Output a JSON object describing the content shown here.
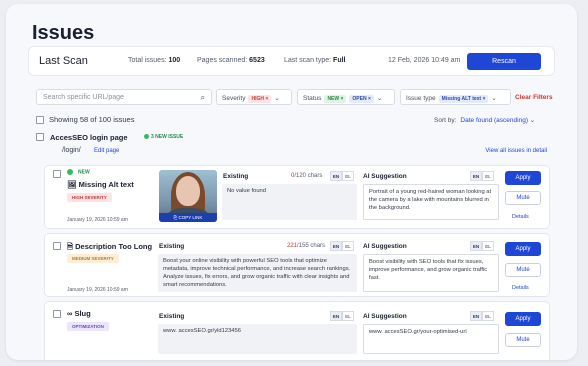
{
  "page": {
    "title": "Issues"
  },
  "scan": {
    "title": "Last Scan",
    "total_label": "Total issues:",
    "total_value": "100",
    "pages_label": "Pages scanned:",
    "pages_value": "6523",
    "type_label": "Last scan type:",
    "type_value": "Full",
    "date": "12 Feb, 2026 10:49 am",
    "rescan": "Rescan"
  },
  "filters": {
    "search_placeholder": "Search specific URL/page",
    "severity_label": "Severity",
    "severity_chip": "HIGH ×",
    "status_label": "Status",
    "status_chip_1": "NEW ×",
    "status_chip_2": "OPEN ×",
    "issue_type_label": "Issue type",
    "issue_type_chip": "Missing ALT text ×",
    "clear": "Clear Filters"
  },
  "list": {
    "showing": "Showing 58 of 100 issues",
    "sort_label": "Sort by:",
    "sort_value": "Date found (ascending)"
  },
  "group": {
    "name": "AccesSEO login page",
    "badge": "3 NEW ISSUE",
    "path": "/login/",
    "edit": "Edit page",
    "view_all": "View all issues in detail"
  },
  "cards": [
    {
      "status": "NEW",
      "title": "Missing Alt text",
      "severity": "HIGH SEVERITY",
      "date": "January 19, 2026 10:59 am",
      "copy_link": "COPY LINK",
      "existing_label": "Existing",
      "chars_used": "0",
      "chars_total": "/120 chars",
      "existing_text": "No value found",
      "ai_label": "AI Suggestion",
      "ai_text": "Portrait of a young red-haired woman looking at the camera by a lake with mountains blurred in the background.",
      "apply": "Apply",
      "mute": "Mute",
      "details": "Details",
      "lang_en": "EN",
      "lang_el": "EL"
    },
    {
      "title": "Description Too Long",
      "severity": "MEDIUM SEVERITY",
      "date": "January 19, 2026 10:59 am",
      "existing_label": "Existing",
      "chars_used": "221",
      "chars_total": "/155 chars",
      "existing_text": "Boost your online visibility with powerful SEO tools that optimize metadata, improve technical performance, and increase search rankings. Analyze issues, fix errors, and grow organic traffic with clear insights and smart recommendations.",
      "ai_label": "AI Suggestion",
      "ai_text": "Boost visibility with SEO tools that fix issues, improve performance, and grow organic traffic fast.",
      "apply": "Apply",
      "mute": "Mute",
      "details": "Details",
      "lang_en": "EN",
      "lang_el": "EL"
    },
    {
      "title": "Slug",
      "severity": "OPTIMIZATION",
      "existing_label": "Existing",
      "existing_text": "www. accesSEO.gr/yld123456",
      "ai_label": "AI Suggestion",
      "ai_text": "www. accesSEO.gr/your-optimised-url",
      "apply": "Apply",
      "mute": "Mute",
      "lang_en": "EN",
      "lang_el": "EL"
    }
  ],
  "icons": {
    "search": "search-icon",
    "image": "image-icon",
    "description": "document-icon",
    "slug": "link-icon",
    "chevron": "chevron-down-icon"
  },
  "colors": {
    "accent": "#1f47d6",
    "danger": "#d0342c",
    "success": "#2fbf5e"
  }
}
